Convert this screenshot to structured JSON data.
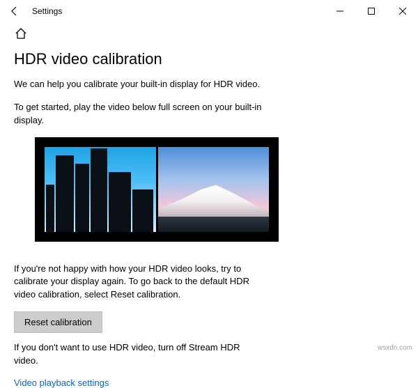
{
  "window": {
    "title": "Settings"
  },
  "page": {
    "heading": "HDR video calibration",
    "intro": "We can help you calibrate your built-in display for HDR video.",
    "instruction": "To get started, play the video below full screen on your built-in display.",
    "recalibrate_hint": "If you're not happy with how your HDR video looks, try to calibrate your display again. To go back to the default HDR video calibration, select Reset calibration.",
    "reset_button": "Reset calibration",
    "turnoff_hint": "If you don't want to use HDR video, turn off Stream HDR video.",
    "link_label": "Video playback settings"
  },
  "watermark": "wsxdn.com"
}
